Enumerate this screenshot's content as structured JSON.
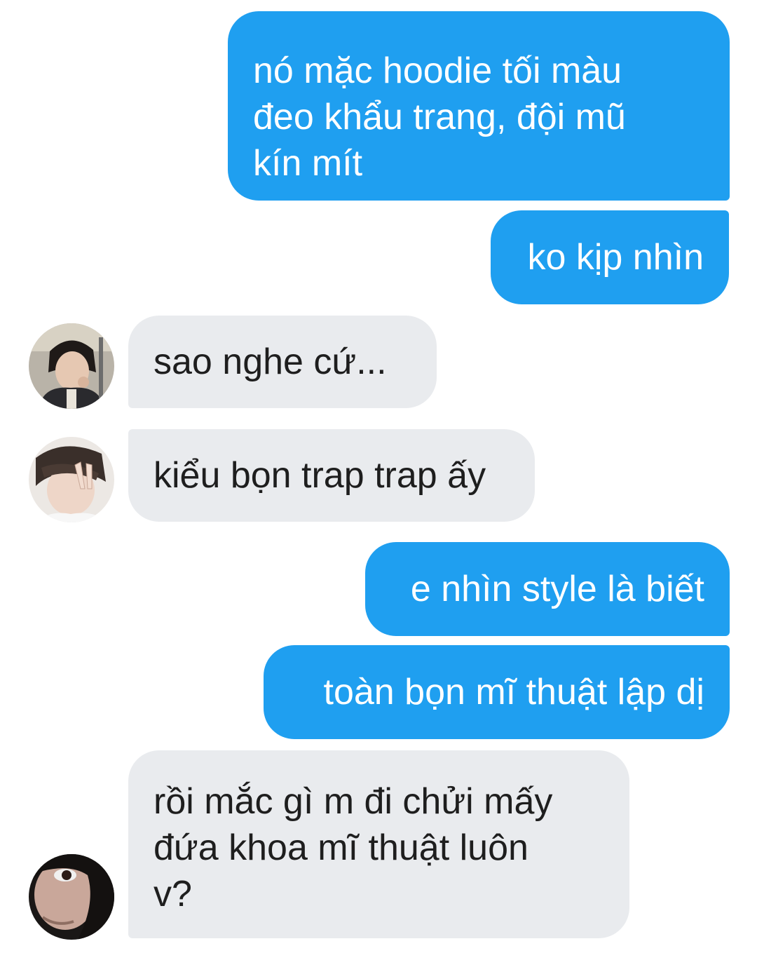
{
  "messages": [
    {
      "id": "m1",
      "side": "outgoing",
      "text": "nó mặc hoodie tối màu\nđeo khẩu trang, đội mũ\nkín mít"
    },
    {
      "id": "m2",
      "side": "outgoing",
      "text": "ko kịp nhìn"
    },
    {
      "id": "m3",
      "side": "incoming",
      "text": "sao nghe cứ..."
    },
    {
      "id": "m4",
      "side": "incoming",
      "text": "kiểu bọn trap trap ấy"
    },
    {
      "id": "m5",
      "side": "outgoing",
      "text": "e nhìn style là biết"
    },
    {
      "id": "m6",
      "side": "outgoing",
      "text": "toàn bọn mĩ thuật lập dị"
    },
    {
      "id": "m7",
      "side": "incoming",
      "text": "rồi mắc gì m đi chửi mấy\nđứa khoa mĩ thuật luôn\nv?"
    }
  ],
  "colors": {
    "outgoing_bubble": "#1f9ff0",
    "outgoing_text": "#ffffff",
    "incoming_bubble": "#e9ebee",
    "incoming_text": "#1e1e1e"
  }
}
